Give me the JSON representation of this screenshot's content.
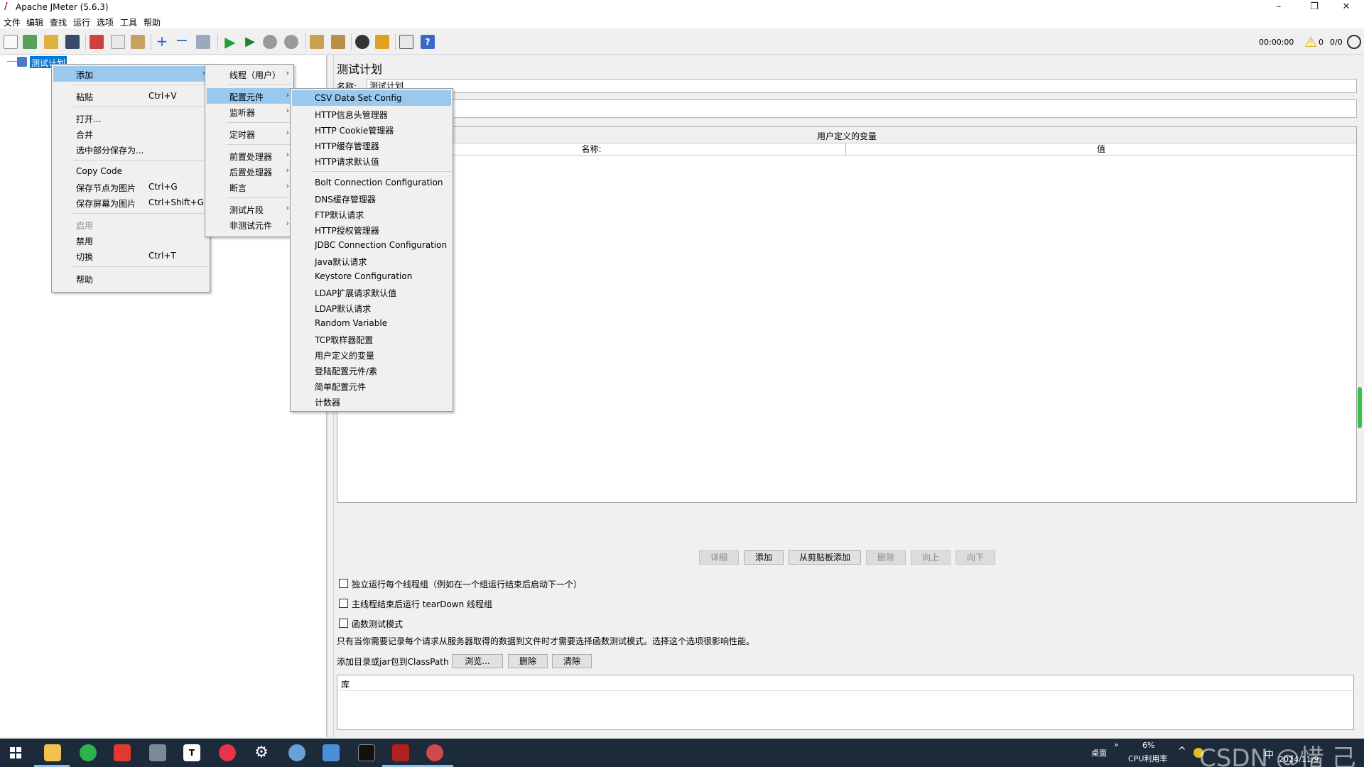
{
  "window": {
    "title": "Apache JMeter (5.6.3)",
    "minimize_glyph": "–",
    "restore_glyph": "❐",
    "close_glyph": "✕"
  },
  "menubar": [
    "文件",
    "编辑",
    "查找",
    "运行",
    "选项",
    "工具",
    "帮助"
  ],
  "toolbar": {
    "icons": [
      "new-icon",
      "templates-icon",
      "open-icon",
      "save-icon",
      "cut-icon",
      "copy-icon",
      "paste-icon",
      "expand-icon",
      "collapse-icon",
      "toggle-icon",
      "start-icon",
      "start-no-pause-icon",
      "stop-icon",
      "shutdown-icon",
      "clear-icon",
      "clear-all-icon",
      "search-icon",
      "reset-search-icon",
      "function-helper-icon",
      "help-icon"
    ],
    "timer": "00:00:00",
    "warning_count": "0",
    "threads": "0/0"
  },
  "tree": {
    "root_label": "测试计划"
  },
  "context_menu": {
    "items": [
      {
        "label": "添加",
        "shortcut": "",
        "submenu": true,
        "highlighted": true
      },
      {
        "label": "粘贴",
        "shortcut": "Ctrl+V"
      },
      {
        "label": "打开..."
      },
      {
        "label": "合并"
      },
      {
        "label": "选中部分保存为..."
      },
      {
        "label": "Copy Code"
      },
      {
        "label": "保存节点为图片",
        "shortcut": "Ctrl+G"
      },
      {
        "label": "保存屏幕为图片",
        "shortcut": "Ctrl+Shift+G"
      },
      {
        "label": "启用",
        "disabled": true
      },
      {
        "label": "禁用"
      },
      {
        "label": "切换",
        "shortcut": "Ctrl+T"
      },
      {
        "label": "帮助"
      }
    ]
  },
  "add_submenu": {
    "items": [
      "线程（用户）",
      "配置元件",
      "监听器",
      "定时器",
      "前置处理器",
      "后置处理器",
      "断言",
      "测试片段",
      "非测试元件"
    ]
  },
  "config_submenu": {
    "items": [
      "CSV Data Set Config",
      "HTTP信息头管理器",
      "HTTP Cookie管理器",
      "HTTP缓存管理器",
      "HTTP请求默认值",
      "Bolt Connection Configuration",
      "DNS缓存管理器",
      "FTP默认请求",
      "HTTP授权管理器",
      "JDBC Connection Configuration",
      "Java默认请求",
      "Keystore Configuration",
      "LDAP扩展请求默认值",
      "LDAP默认请求",
      "Random Variable",
      "TCP取样器配置",
      "用户定义的变量",
      "登陆配置元件/素",
      "简单配置元件",
      "计数器"
    ]
  },
  "test_plan": {
    "heading": "测试计划",
    "name_label": "名称:",
    "name_value": "测试计划",
    "vars_title": "用户定义的变量",
    "col_name": "名称:",
    "col_value": "值",
    "buttons": [
      "详细",
      "添加",
      "从剪贴板添加",
      "删除",
      "向上",
      "向下"
    ],
    "checkbox1": "独立运行每个线程组（例如在一个组运行结束后启动下一个）",
    "checkbox2": "主线程结束后运行 tearDown 线程组",
    "checkbox3": "函数测试模式",
    "note": "只有当你需要记录每个请求从服务器取得的数据到文件时才需要选择函数测试模式。选择这个选项很影响性能。",
    "classpath_label": "添加目录或jar包到ClassPath",
    "classpath_buttons": [
      "浏览...",
      "删除",
      "清除"
    ],
    "lib_header": "库"
  },
  "taskbar": {
    "desktop_label": "桌面",
    "chevron": "»",
    "cpu_percent": "6%",
    "cpu_label": "CPU利用率",
    "ime": "中",
    "date": "2024/11/9",
    "watermark": "CSDN @惜 己"
  },
  "colors": {
    "highlight": "#99c9ef",
    "taskbar": "#1c2a3a",
    "tree_selected": "#0078d7"
  }
}
